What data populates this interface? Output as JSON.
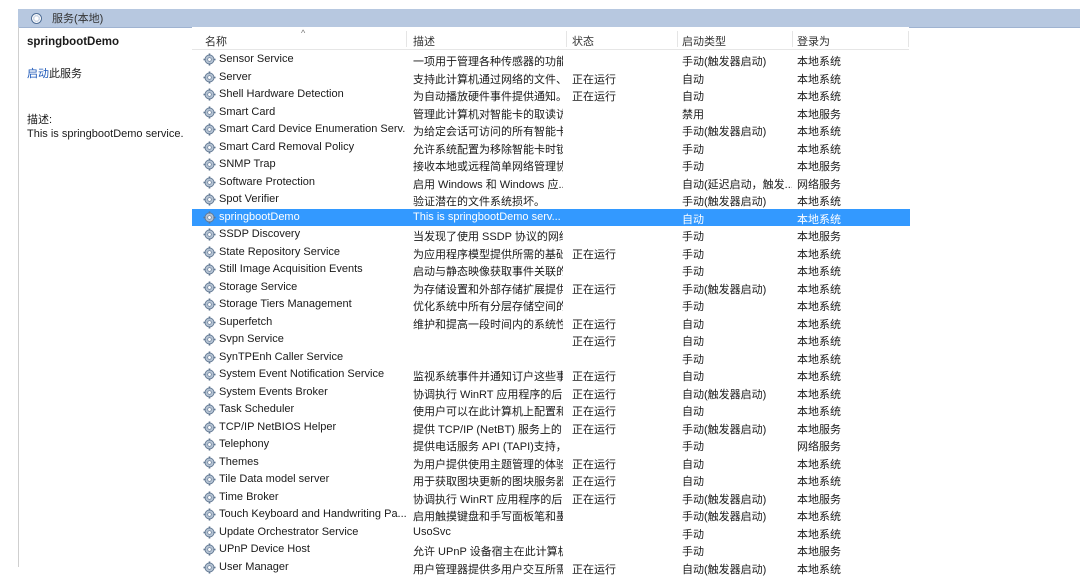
{
  "window": {
    "tab_title": "服务(本地)"
  },
  "left_panel": {
    "service_title": "springbootDemo",
    "start_link": "启动",
    "start_suffix": "此服务",
    "desc_label": "描述:",
    "desc_text": "This is springbootDemo service."
  },
  "columns": {
    "name": "名称",
    "desc": "描述",
    "status": "状态",
    "startup": "启动类型",
    "logon": "登录为"
  },
  "services": [
    {
      "name": "Sensor Service",
      "desc": "一项用于管理各种传感器的功能...",
      "status": "",
      "startup": "手动(触发器启动)",
      "logon": "本地系统"
    },
    {
      "name": "Server",
      "desc": "支持此计算机通过网络的文件、...",
      "status": "正在运行",
      "startup": "自动",
      "logon": "本地系统"
    },
    {
      "name": "Shell Hardware Detection",
      "desc": "为自动播放硬件事件提供通知。",
      "status": "正在运行",
      "startup": "自动",
      "logon": "本地系统"
    },
    {
      "name": "Smart Card",
      "desc": "管理此计算机对智能卡的取读访...",
      "status": "",
      "startup": "禁用",
      "logon": "本地服务"
    },
    {
      "name": "Smart Card Device Enumeration Serv...",
      "desc": "为给定会话可访问的所有智能卡...",
      "status": "",
      "startup": "手动(触发器启动)",
      "logon": "本地系统"
    },
    {
      "name": "Smart Card Removal Policy",
      "desc": "允许系统配置为移除智能卡时锁...",
      "status": "",
      "startup": "手动",
      "logon": "本地系统"
    },
    {
      "name": "SNMP Trap",
      "desc": "接收本地或远程简单网络管理协...",
      "status": "",
      "startup": "手动",
      "logon": "本地服务"
    },
    {
      "name": "Software Protection",
      "desc": "启用 Windows 和 Windows 应...",
      "status": "",
      "startup": "自动(延迟启动，触发...",
      "logon": "网络服务"
    },
    {
      "name": "Spot Verifier",
      "desc": "验证潜在的文件系统损坏。",
      "status": "",
      "startup": "手动(触发器启动)",
      "logon": "本地系统"
    },
    {
      "name": "springbootDemo",
      "desc": "This is springbootDemo serv...",
      "status": "",
      "startup": "自动",
      "logon": "本地系统",
      "selected": true
    },
    {
      "name": "SSDP Discovery",
      "desc": "当发现了使用 SSDP 协议的网络...",
      "status": "",
      "startup": "手动",
      "logon": "本地服务"
    },
    {
      "name": "State Repository Service",
      "desc": "为应用程序模型提供所需的基础...",
      "status": "正在运行",
      "startup": "手动",
      "logon": "本地系统"
    },
    {
      "name": "Still Image Acquisition Events",
      "desc": "启动与静态映像获取事件关联的...",
      "status": "",
      "startup": "手动",
      "logon": "本地系统"
    },
    {
      "name": "Storage Service",
      "desc": "为存储设置和外部存储扩展提供...",
      "status": "正在运行",
      "startup": "手动(触发器启动)",
      "logon": "本地系统"
    },
    {
      "name": "Storage Tiers Management",
      "desc": "优化系统中所有分层存储空间的...",
      "status": "",
      "startup": "手动",
      "logon": "本地系统"
    },
    {
      "name": "Superfetch",
      "desc": "维护和提高一段时间内的系统性...",
      "status": "正在运行",
      "startup": "自动",
      "logon": "本地系统"
    },
    {
      "name": "Svpn Service",
      "desc": "",
      "status": "正在运行",
      "startup": "自动",
      "logon": "本地系统"
    },
    {
      "name": "SynTPEnh Caller Service",
      "desc": "",
      "status": "",
      "startup": "手动",
      "logon": "本地系统"
    },
    {
      "name": "System Event Notification Service",
      "desc": "监视系统事件并通知订户这些事...",
      "status": "正在运行",
      "startup": "自动",
      "logon": "本地系统"
    },
    {
      "name": "System Events Broker",
      "desc": "协调执行 WinRT 应用程序的后...",
      "status": "正在运行",
      "startup": "自动(触发器启动)",
      "logon": "本地系统"
    },
    {
      "name": "Task Scheduler",
      "desc": "使用户可以在此计算机上配置和...",
      "status": "正在运行",
      "startup": "自动",
      "logon": "本地系统"
    },
    {
      "name": "TCP/IP NetBIOS Helper",
      "desc": "提供 TCP/IP (NetBT) 服务上的 ...",
      "status": "正在运行",
      "startup": "手动(触发器启动)",
      "logon": "本地服务"
    },
    {
      "name": "Telephony",
      "desc": "提供电话服务 API (TAPI)支持，...",
      "status": "",
      "startup": "手动",
      "logon": "网络服务"
    },
    {
      "name": "Themes",
      "desc": "为用户提供使用主题管理的体验...",
      "status": "正在运行",
      "startup": "自动",
      "logon": "本地系统"
    },
    {
      "name": "Tile Data model server",
      "desc": "用于获取图块更新的图块服务器...",
      "status": "正在运行",
      "startup": "自动",
      "logon": "本地系统"
    },
    {
      "name": "Time Broker",
      "desc": "协调执行 WinRT 应用程序的后...",
      "status": "正在运行",
      "startup": "手动(触发器启动)",
      "logon": "本地服务"
    },
    {
      "name": "Touch Keyboard and Handwriting Pa...",
      "desc": "启用触摸键盘和手写面板笔和墨...",
      "status": "",
      "startup": "手动(触发器启动)",
      "logon": "本地系统"
    },
    {
      "name": "Update Orchestrator Service",
      "desc": "UsoSvc",
      "status": "",
      "startup": "手动",
      "logon": "本地系统"
    },
    {
      "name": "UPnP Device Host",
      "desc": "允许 UPnP 设备宿主在此计算机...",
      "status": "",
      "startup": "手动",
      "logon": "本地服务"
    },
    {
      "name": "User Manager",
      "desc": "用户管理器提供多用户交互所需...",
      "status": "正在运行",
      "startup": "自动(触发器启动)",
      "logon": "本地系统"
    }
  ]
}
